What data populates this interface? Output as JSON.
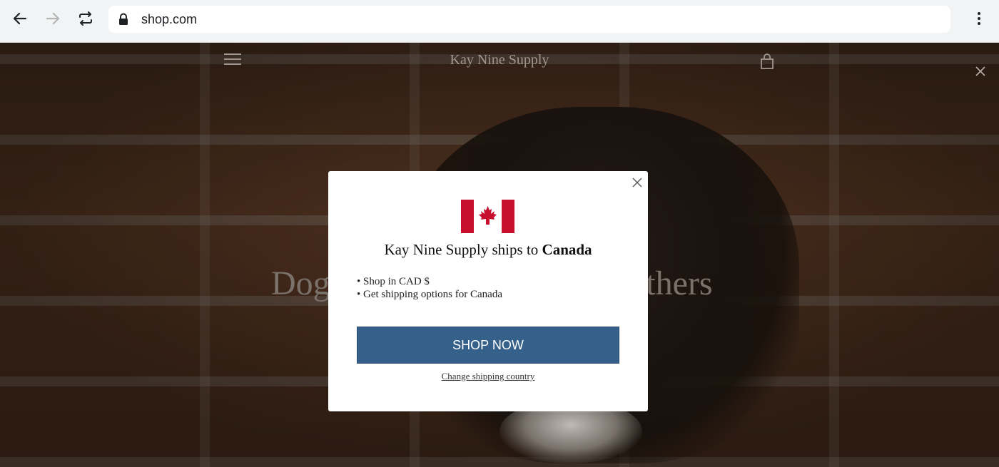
{
  "browser": {
    "url": "shop.com",
    "icons": {
      "back": "arrow-left-icon",
      "forward": "arrow-right-icon",
      "reload": "reload-icon",
      "lock": "lock-icon",
      "menu": "kebab-menu-icon"
    }
  },
  "site": {
    "title": "Kay Nine Supply",
    "hero_heading_left": "Dog",
    "hero_heading_right": "athers",
    "icons": {
      "menu": "hamburger-icon",
      "cart": "shopping-bag-icon",
      "close": "close-icon"
    }
  },
  "modal": {
    "title_prefix": "Kay Nine Supply ships to ",
    "country": "Canada",
    "bullets": [
      "• Shop in CAD $",
      "• Get shipping options for Canada"
    ],
    "cta_label": "SHOP NOW",
    "change_link": "Change shipping country",
    "flag": "canada-flag-icon",
    "colors": {
      "cta": "#35608a",
      "flag_red": "#c8102e"
    }
  }
}
